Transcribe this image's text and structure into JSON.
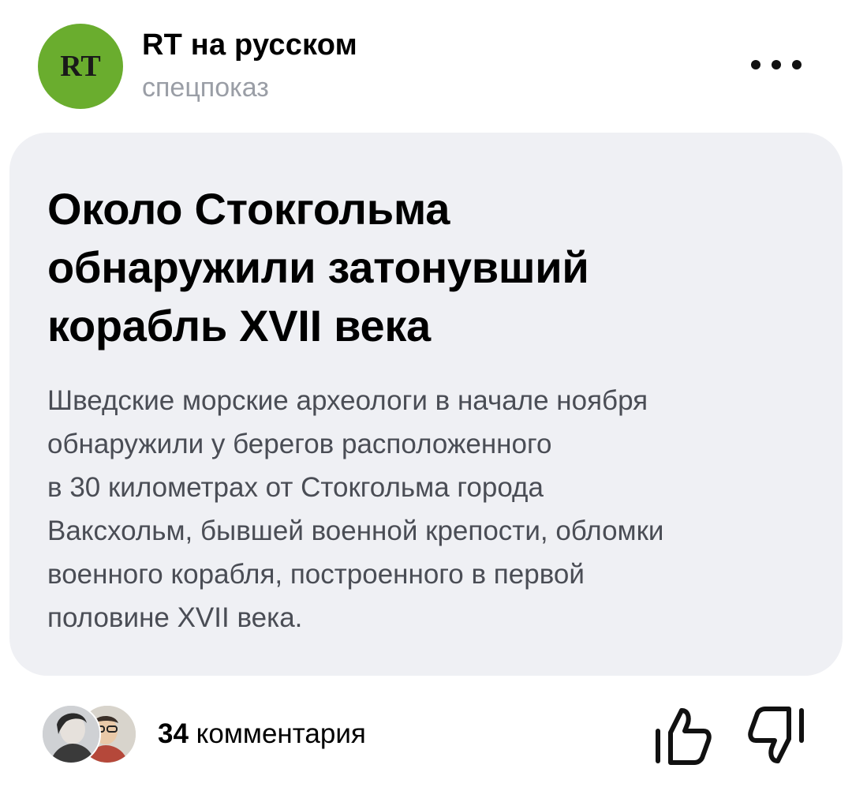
{
  "header": {
    "channel_name": "RT на русском",
    "channel_subtitle": "спецпоказ",
    "avatar_text": "RT",
    "avatar_color": "#6aad2e"
  },
  "card": {
    "title_lines": [
      "Около Стокгольма",
      "обнаружили затонувший",
      "корабль XVII века"
    ],
    "text_lines": [
      "Шведские морские археологи в начале ноября",
      "обнаружили у берегов расположенного",
      "в 30 километрах от Стокгольма города",
      "Ваксхольм, бывшей военной крепости, обломки",
      "военного корабля, построенного в первой",
      "половине XVII века."
    ],
    "background_color": "#eff0f4"
  },
  "footer": {
    "comments_count": "34",
    "comments_label": "комментария",
    "icons": {
      "like": "thumbs-up-icon",
      "dislike": "thumbs-down-icon",
      "more": "more-dots-icon"
    }
  }
}
